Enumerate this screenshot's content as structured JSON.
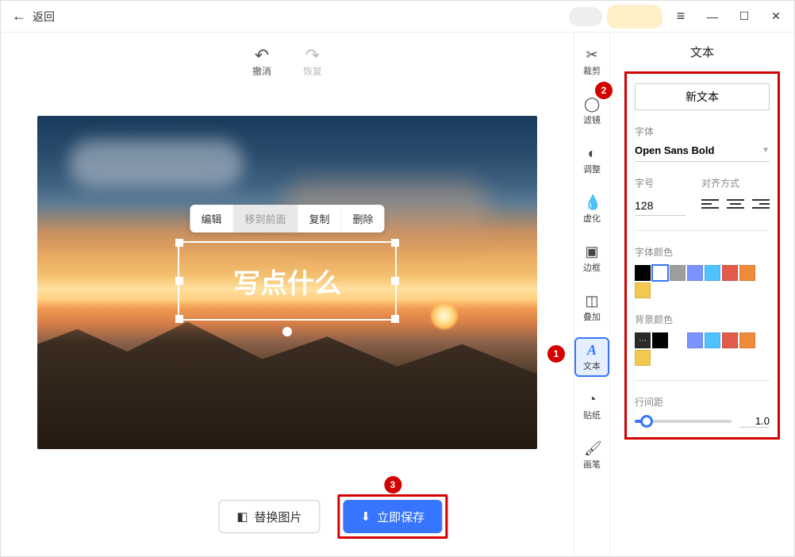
{
  "header": {
    "back": "返回"
  },
  "undo_redo": {
    "undo": "撤消",
    "redo": "恢复"
  },
  "text_toolbar": {
    "edit": "编辑",
    "bring_front": "移到前面",
    "copy": "复制",
    "delete": "删除"
  },
  "text_placeholder": "写点什么",
  "bottom": {
    "replace": "替换图片",
    "save": "立即保存"
  },
  "tools": {
    "crop": "裁剪",
    "filter": "滤镜",
    "adjust": "调整",
    "blur": "虚化",
    "border": "边框",
    "overlay": "叠加",
    "text": "文本",
    "sticker": "贴纸",
    "brush": "画笔"
  },
  "panel": {
    "title": "文本",
    "new_text": "新文本",
    "font_label": "字体",
    "font_name": "Open Sans Bold",
    "size_label": "字号",
    "size_value": "128",
    "align_label": "对齐方式",
    "font_color_label": "字体颜色",
    "bg_color_label": "背景颜色",
    "line_spacing_label": "行间距",
    "line_spacing_value": "1.0",
    "font_colors": [
      "#000000",
      "selected-white",
      "#9e9e9e",
      "#7a93ff",
      "#4fc3ff",
      "#e25a4a",
      "#ef8a3b",
      "#f2c94c"
    ],
    "bg_colors": [
      "ellipsis",
      "#000000",
      "spacer",
      "#7a93ff",
      "#4fc3ff",
      "#e25a4a",
      "#ef8a3b",
      "#f2c94c"
    ]
  },
  "markers": {
    "m1": "1",
    "m2": "2",
    "m3": "3"
  }
}
